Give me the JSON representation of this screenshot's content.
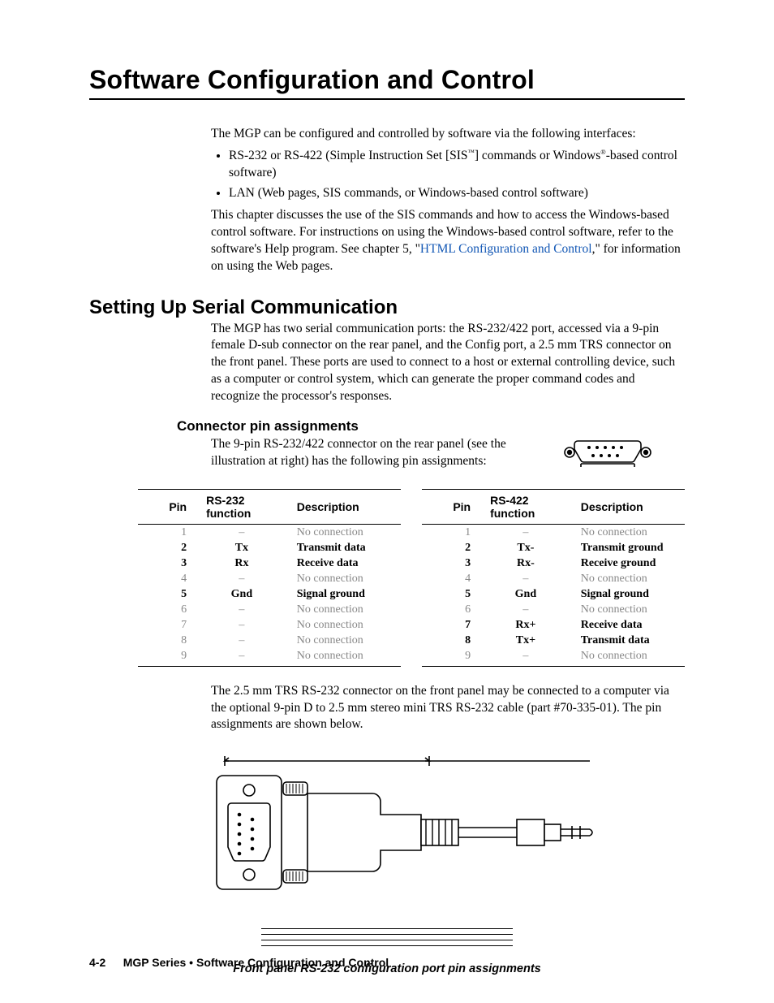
{
  "chapter_title": "Software Configuration and Control",
  "intro": {
    "lead": "The MGP can be configured and controlled by software via the following interfaces:",
    "bullet1_pre": "RS-232 or RS-422 (Simple Instruction Set [SIS",
    "bullet1_tm": "™",
    "bullet1_mid": "] commands or Windows",
    "bullet1_reg": "®",
    "bullet1_post": "-based control software)",
    "bullet2": "LAN (Web pages, SIS commands, or Windows-based control software)",
    "para2_pre": "This chapter discusses the use of the SIS commands and how to access the Windows-based control software.  For instructions on using the Windows-based control software, refer to the software's Help program.  See chapter 5, \"",
    "para2_link": "HTML Configuration and Control",
    "para2_post": ",\" for information on using the Web pages."
  },
  "section1": {
    "heading": "Setting Up Serial Communication",
    "para": "The MGP has two serial communication ports: the RS-232/422 port, accessed via a 9-pin female D-sub connector on the rear panel, and the Config port, a 2.5 mm TRS connector on the front panel.  These ports are used to connect to a host or external controlling device, such as a computer or control system, which can generate the proper command codes and recognize the processor's responses."
  },
  "subsection1": {
    "heading": "Connector pin assignments",
    "note": "The 9-pin RS-232/422 connector on the rear panel (see the illustration at right) has the following pin assignments:"
  },
  "table232": {
    "h1": "Pin",
    "h2": "RS-232 function",
    "h3": "Description",
    "rows": [
      {
        "p": "1",
        "f": "–",
        "d": "No connection",
        "dim": true
      },
      {
        "p": "2",
        "f": "Tx",
        "d": "Transmit data",
        "dim": false
      },
      {
        "p": "3",
        "f": "Rx",
        "d": "Receive data",
        "dim": false
      },
      {
        "p": "4",
        "f": "–",
        "d": "No connection",
        "dim": true
      },
      {
        "p": "5",
        "f": "Gnd",
        "d": "Signal ground",
        "dim": false
      },
      {
        "p": "6",
        "f": "–",
        "d": "No connection",
        "dim": true
      },
      {
        "p": "7",
        "f": "–",
        "d": "No connection",
        "dim": true
      },
      {
        "p": "8",
        "f": "–",
        "d": "No connection",
        "dim": true
      },
      {
        "p": "9",
        "f": "–",
        "d": "No connection",
        "dim": true
      }
    ]
  },
  "table422": {
    "h1": "Pin",
    "h2": "RS-422 function",
    "h3": "Description",
    "rows": [
      {
        "p": "1",
        "f": "–",
        "d": "No connection",
        "dim": true
      },
      {
        "p": "2",
        "f": "Tx-",
        "d": "Transmit ground",
        "dim": false
      },
      {
        "p": "3",
        "f": "Rx-",
        "d": "Receive ground",
        "dim": false
      },
      {
        "p": "4",
        "f": "–",
        "d": "No connection",
        "dim": true
      },
      {
        "p": "5",
        "f": "Gnd",
        "d": "Signal ground",
        "dim": false
      },
      {
        "p": "6",
        "f": "–",
        "d": "No connection",
        "dim": true
      },
      {
        "p": "7",
        "f": "Rx+",
        "d": "Receive data",
        "dim": false
      },
      {
        "p": "8",
        "f": "Tx+",
        "d": "Transmit data",
        "dim": false
      },
      {
        "p": "9",
        "f": "–",
        "d": "No connection",
        "dim": true
      }
    ]
  },
  "trs_para": "The 2.5 mm TRS RS-232 connector on the front panel may be connected to a computer via the optional 9-pin D to 2.5 mm stereo mini TRS RS-232 cable (part #70-335-01).  The pin assignments are shown below.",
  "figure_caption": "Front panel RS-232 configuration port pin assignments",
  "footer": {
    "page": "4-2",
    "crumb": "MGP Series • Software Configuration and Control"
  }
}
